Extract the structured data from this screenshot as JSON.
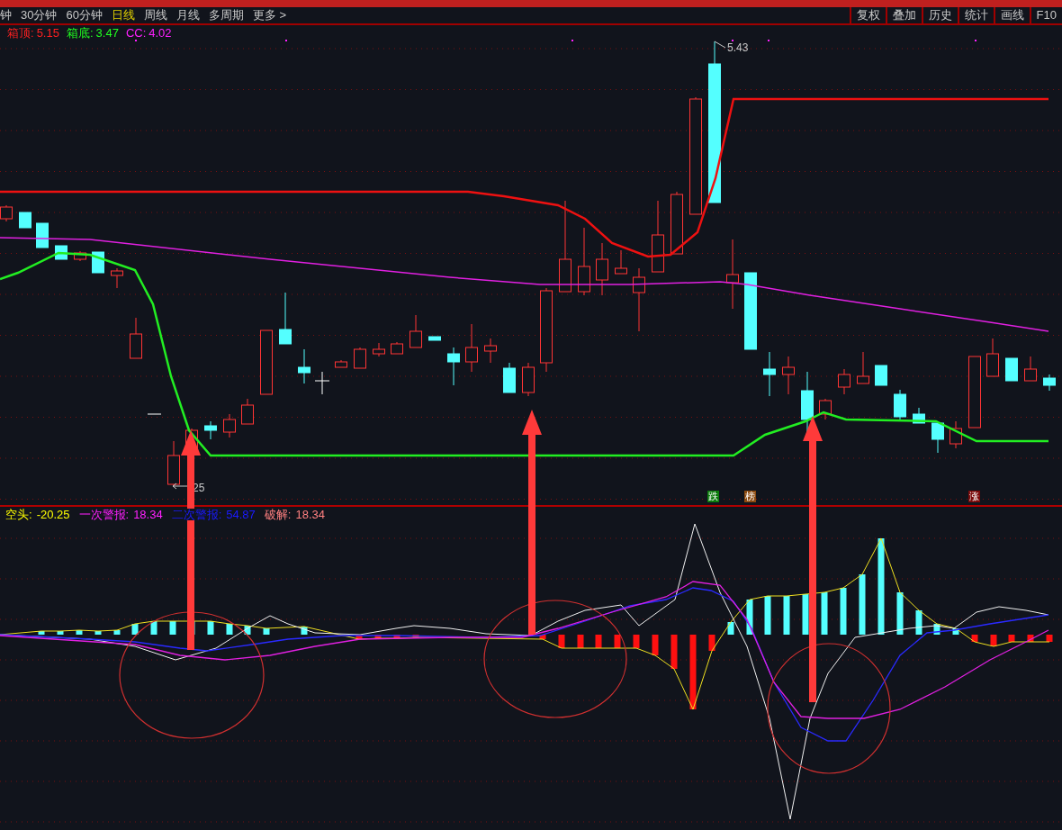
{
  "toolbar": {
    "periods": [
      {
        "label": "钟",
        "selected": false
      },
      {
        "label": "30分钟",
        "selected": false
      },
      {
        "label": "60分钟",
        "selected": false
      },
      {
        "label": "日线",
        "selected": true
      },
      {
        "label": "周线",
        "selected": false
      },
      {
        "label": "月线",
        "selected": false
      },
      {
        "label": "多周期",
        "selected": false
      },
      {
        "label": "更多 >",
        "selected": false
      }
    ],
    "buttons": [
      "复权",
      "叠加",
      "历史",
      "统计",
      "画线",
      "F10"
    ]
  },
  "price_panel": {
    "legend": [
      {
        "label": "箱顶:",
        "value": "5.15",
        "color": "#ff2020"
      },
      {
        "label": "箱底:",
        "value": "3.47",
        "color": "#20ff20"
      },
      {
        "label": "CC:",
        "value": "4.02",
        "color": "#ff20ff"
      }
    ],
    "high_label": "5.43",
    "low_label": "25",
    "signals": [
      {
        "label": "跌",
        "color": "#0b7a0b"
      },
      {
        "label": "榜",
        "color": "#8b4a10"
      },
      {
        "label": "涨",
        "color": "#7a0a0a"
      }
    ]
  },
  "indicator_panel": {
    "legend": [
      {
        "label": "空头:",
        "value": "-20.25",
        "color": "#ffff00"
      },
      {
        "label": "一次警报:",
        "value": "18.34",
        "color": "#ff20ff"
      },
      {
        "label": "二次警报:",
        "value": "54.87",
        "color": "#1a1aff"
      },
      {
        "label": "破解:",
        "value": "18.34",
        "color": "#ff8080"
      }
    ]
  }
}
